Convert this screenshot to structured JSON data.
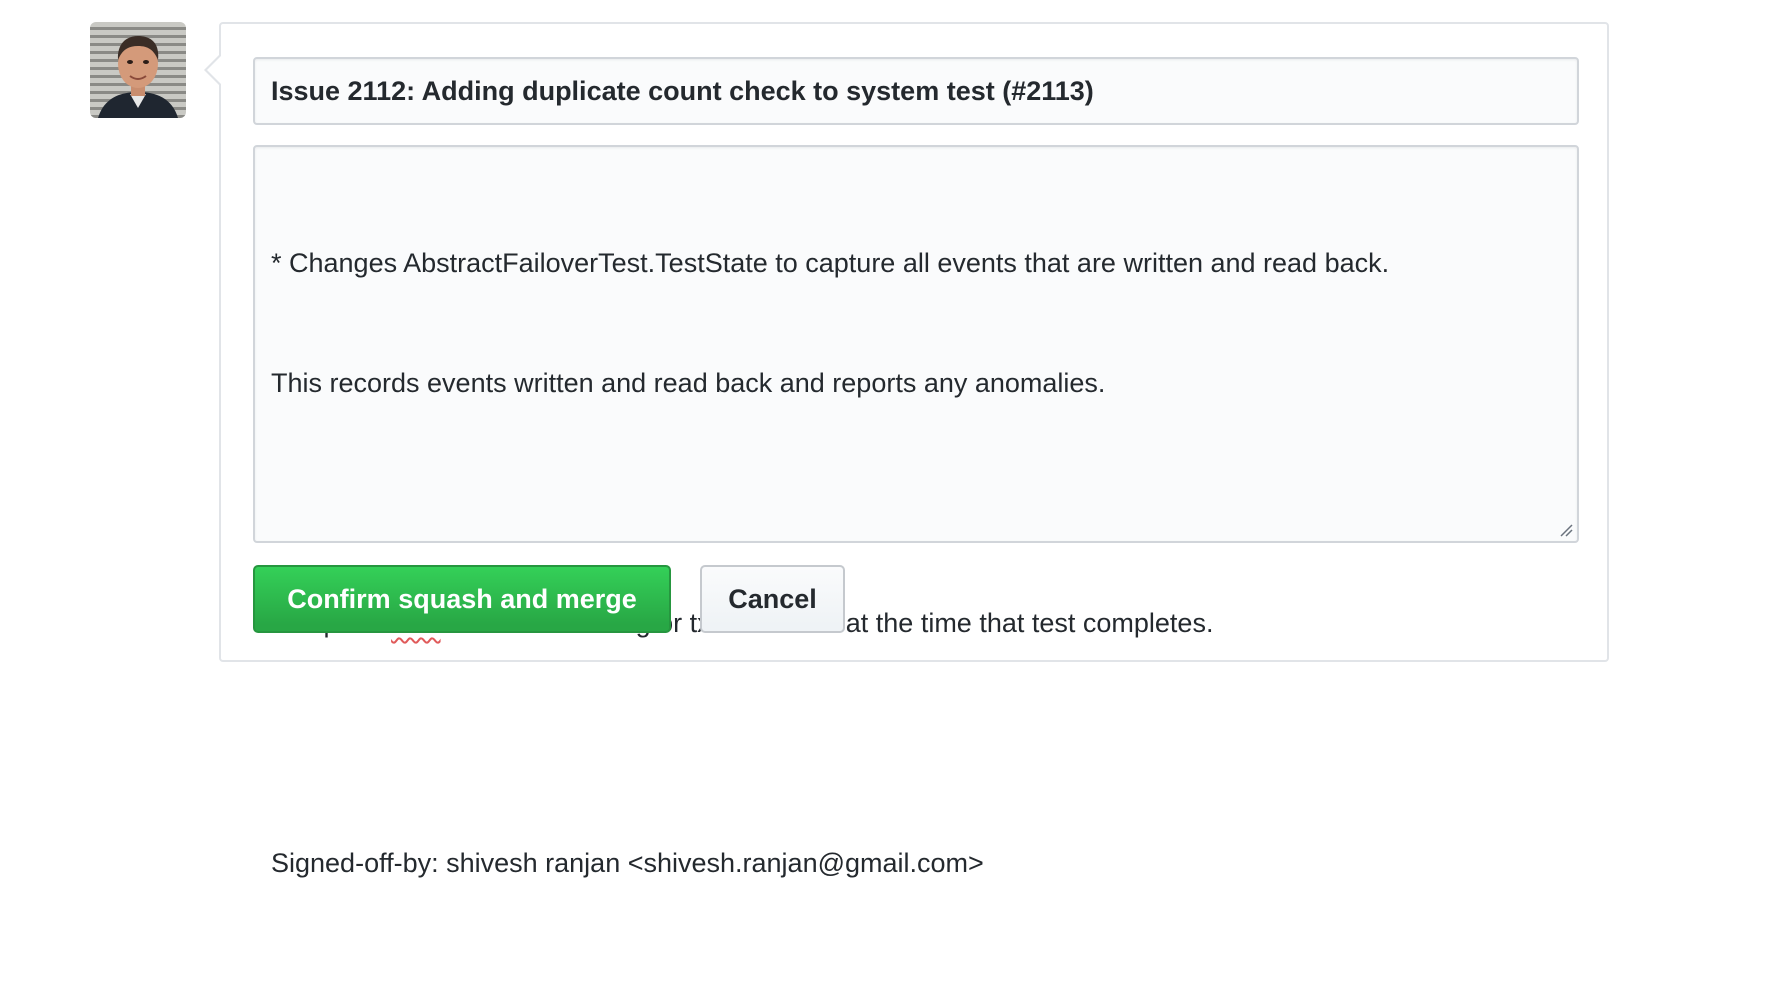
{
  "avatar": {
    "icon": "user-avatar-photo"
  },
  "merge_form": {
    "commit_title": "Issue 2112: Adding duplicate count check to system test (#2113)",
    "commit_message": {
      "line1": "* Changes AbstractFailoverTest.TestState to capture all events that are written and read back.",
      "line2": "This records events written and read back and reports any anomalies.",
      "line3": "",
      "line4_before": "* Reports ",
      "line4_misspelled": "txns",
      "line4_after": " left in committing or txns aborted at the time that test completes.",
      "line5": "",
      "line6": "Signed-off-by: shivesh ranjan <shivesh.ranjan@gmail.com>"
    },
    "confirm_label": "Confirm squash and merge",
    "cancel_label": "Cancel"
  },
  "colors": {
    "primary_button": "#28a745",
    "border": "#e1e4e8",
    "text": "#24292e",
    "spellcheck_underline": "#e05a5a"
  }
}
